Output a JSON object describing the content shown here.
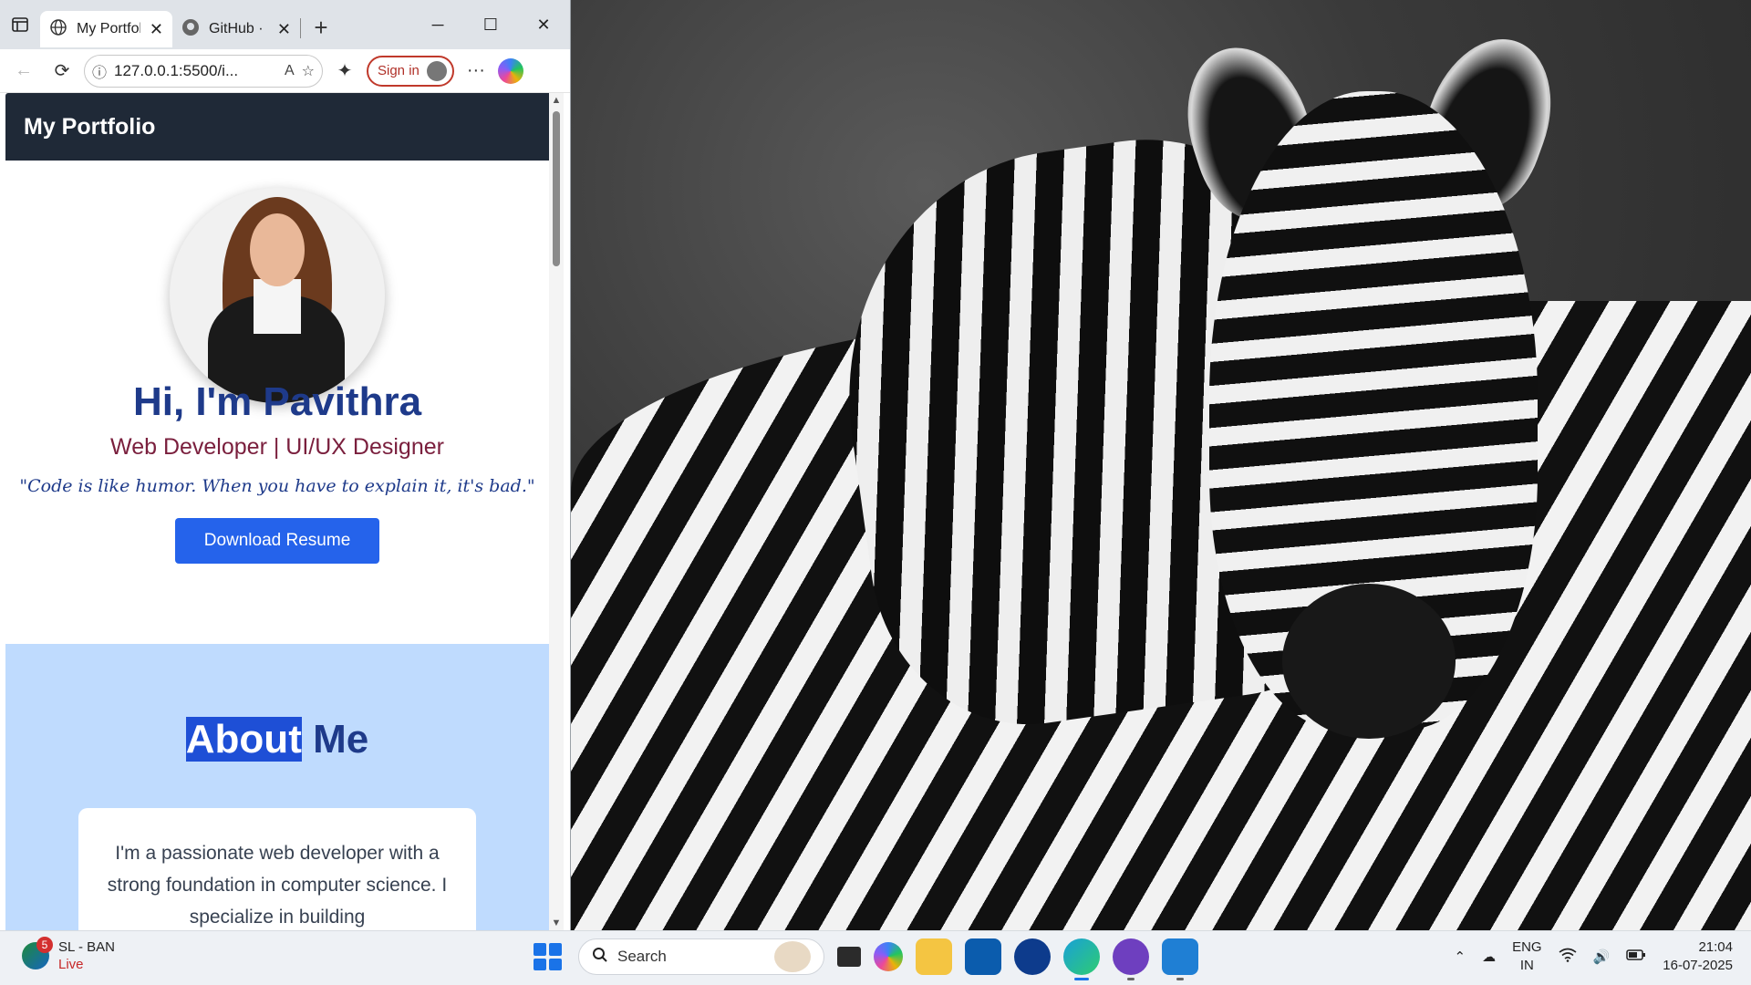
{
  "browser": {
    "tabs": [
      {
        "title": "My Portfolio",
        "active": true
      },
      {
        "title": "GitHub · B",
        "active": false
      }
    ],
    "address": "127.0.0.1:5500/i...",
    "signin_label": "Sign in"
  },
  "site": {
    "header_title": "My Portfolio",
    "hero": {
      "name": "Hi, I'm Pavithra",
      "role": "Web Developer | UI/UX Designer",
      "quote": "\"Code is like humor. When you have to explain it, it's bad.\"",
      "resume_button": "Download Resume"
    },
    "about": {
      "title_highlight": "About",
      "title_rest": " Me",
      "text": "I'm a passionate web developer with a strong foundation in computer science. I specialize in building"
    }
  },
  "taskbar": {
    "widget": {
      "title": "SL - BAN",
      "status": "Live",
      "badge": "5"
    },
    "search_placeholder": "Search",
    "tray": {
      "lang_top": "ENG",
      "lang_bottom": "IN",
      "time": "21:04",
      "date": "16-07-2025"
    }
  },
  "colors": {
    "site_header_bg": "#1f2937",
    "accent_blue": "#2563eb",
    "heading_blue": "#1e3a8a",
    "role_maroon": "#7a1f3d",
    "about_bg": "#bfdbfe"
  }
}
